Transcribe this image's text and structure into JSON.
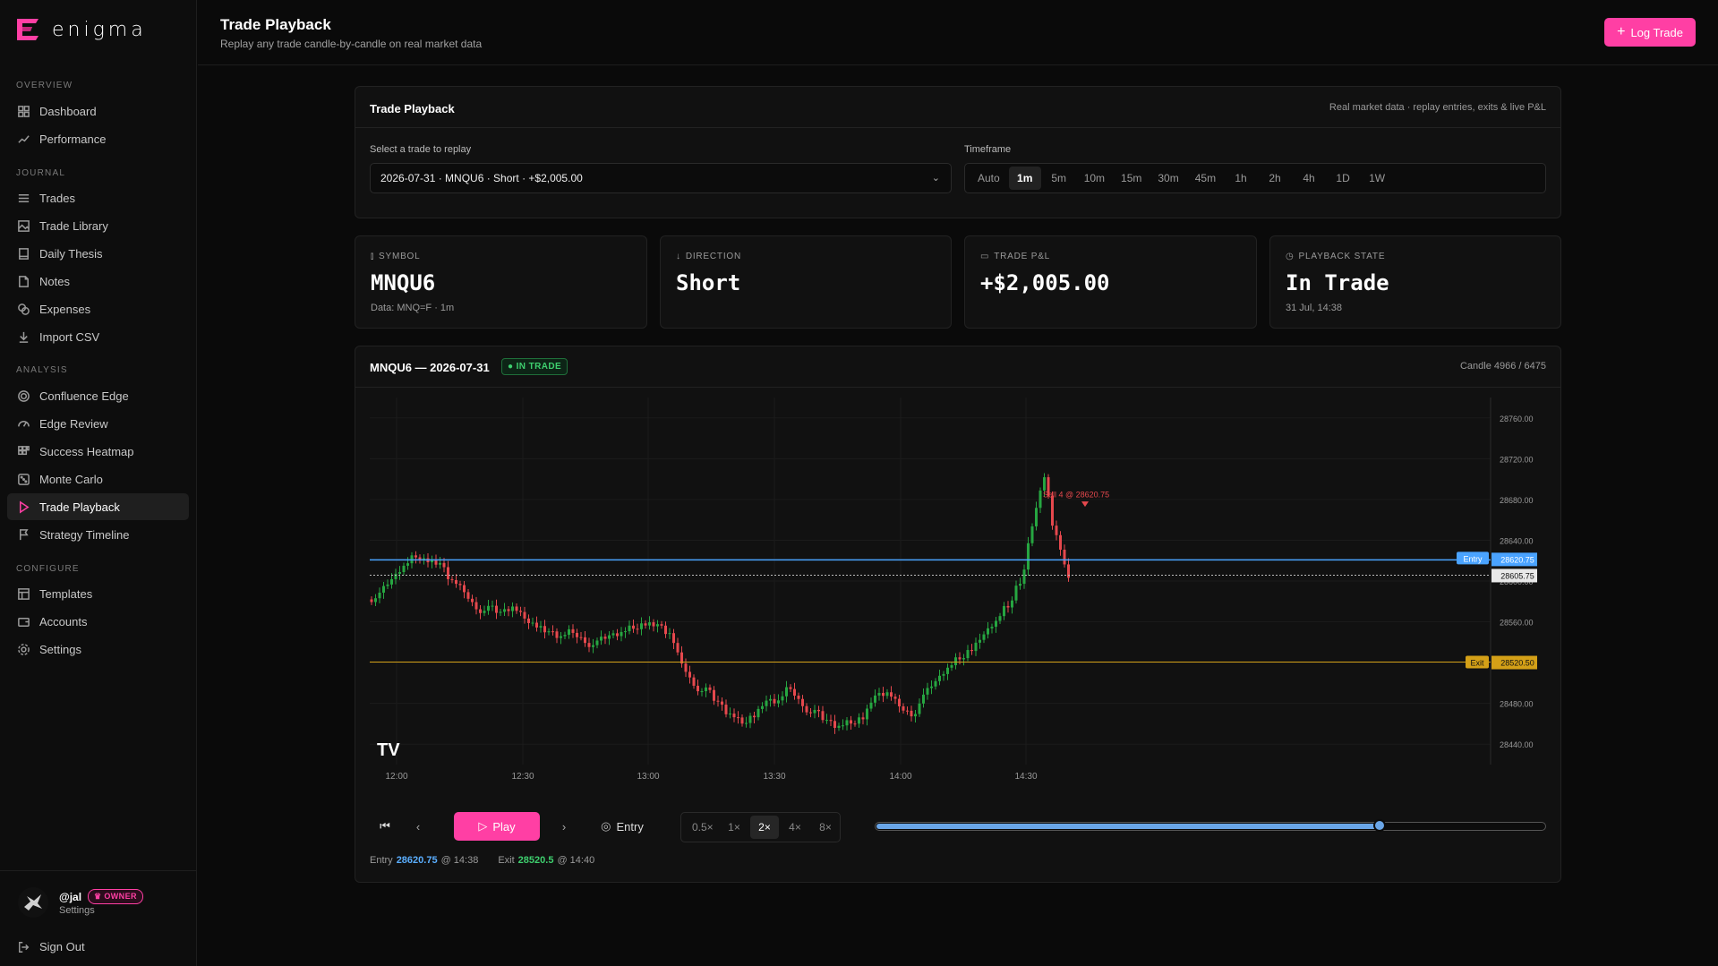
{
  "app": {
    "name": "enigma"
  },
  "sidebar": {
    "sections": [
      {
        "label": "OVERVIEW",
        "items": [
          {
            "label": "Dashboard",
            "icon": "grid-icon"
          },
          {
            "label": "Performance",
            "icon": "trend-icon"
          }
        ]
      },
      {
        "label": "JOURNAL",
        "items": [
          {
            "label": "Trades",
            "icon": "list-icon"
          },
          {
            "label": "Trade Library",
            "icon": "image-icon"
          },
          {
            "label": "Daily Thesis",
            "icon": "book-icon"
          },
          {
            "label": "Notes",
            "icon": "note-icon"
          },
          {
            "label": "Expenses",
            "icon": "coins-icon"
          },
          {
            "label": "Import CSV",
            "icon": "download-icon"
          }
        ]
      },
      {
        "label": "ANALYSIS",
        "items": [
          {
            "label": "Confluence Edge",
            "icon": "target-icon"
          },
          {
            "label": "Edge Review",
            "icon": "gauge-icon"
          },
          {
            "label": "Success Heatmap",
            "icon": "heatmap-icon"
          },
          {
            "label": "Monte Carlo",
            "icon": "dice-icon"
          },
          {
            "label": "Trade Playback",
            "icon": "play-icon",
            "active": true
          },
          {
            "label": "Strategy Timeline",
            "icon": "flag-icon"
          }
        ]
      },
      {
        "label": "CONFIGURE",
        "items": [
          {
            "label": "Templates",
            "icon": "layout-icon"
          },
          {
            "label": "Accounts",
            "icon": "wallet-icon"
          },
          {
            "label": "Settings",
            "icon": "gear-icon"
          }
        ]
      }
    ],
    "user": {
      "handle": "@jal",
      "badge": "OWNER",
      "settings_label": "Settings"
    },
    "sign_out": "Sign Out"
  },
  "header": {
    "title": "Trade Playback",
    "subtitle": "Replay any trade candle-by-candle on real market data",
    "log_trade": "Log Trade"
  },
  "selector": {
    "title": "Trade Playback",
    "note": "Real market data · replay entries, exits & live P&L",
    "trade_label": "Select a trade to replay",
    "trade_value": "2026-07-31 · MNQU6 · Short · +$2,005.00",
    "timeframe_label": "Timeframe",
    "timeframes": [
      "Auto",
      "1m",
      "5m",
      "10m",
      "15m",
      "30m",
      "45m",
      "1h",
      "2h",
      "4h",
      "1D",
      "1W"
    ],
    "timeframe_selected": "1m"
  },
  "stats": [
    {
      "label": "SYMBOL",
      "value": "MNQU6",
      "sub": "Data: MNQ=F · 1m",
      "icon": "candles-icon"
    },
    {
      "label": "DIRECTION",
      "value": "Short",
      "sub": "",
      "icon": "arrow-down-icon"
    },
    {
      "label": "TRADE P&L",
      "value": "+$2,005.00",
      "sub": "",
      "icon": "wallet-icon"
    },
    {
      "label": "PLAYBACK STATE",
      "value": "In Trade",
      "sub": "31 Jul, 14:38",
      "icon": "clock-icon"
    }
  ],
  "chart_panel": {
    "title": "MNQU6 — 2026-07-31",
    "state_badge": "IN TRADE",
    "candle_counter": "Candle 4966 / 6475",
    "entry_tag": "Entry",
    "entry_price": "28620.75",
    "current_price": "28605.75",
    "exit_tag": "Exit",
    "exit_price": "28520.50",
    "sell_annotation": "Sell 4 @ 28620.75",
    "watermark": "TV"
  },
  "chart_data": {
    "type": "candlestick",
    "x_ticks": [
      "12:00",
      "12:30",
      "13:00",
      "13:30",
      "14:00",
      "14:30"
    ],
    "y_ticks": [
      "28760.00",
      "28720.00",
      "28680.00",
      "28640.00",
      "28600.00",
      "28560.00",
      "28520.00",
      "28480.00",
      "28440.00"
    ],
    "ylim": [
      28420,
      28780
    ],
    "entry": 28620.75,
    "current": 28605.75,
    "exit": 28520.5,
    "closes": [
      28585,
      28600,
      28615,
      28625,
      28622,
      28615,
      28600,
      28590,
      28575,
      28572,
      28568,
      28575,
      28565,
      28558,
      28548,
      28545,
      28550,
      28542,
      28538,
      28545,
      28550,
      28555,
      28560,
      28555,
      28548,
      28520,
      28500,
      28492,
      28480,
      28470,
      28462,
      28470,
      28480,
      28482,
      28495,
      28480,
      28470,
      28462,
      28458,
      28462,
      28468,
      28485,
      28490,
      28478,
      28470,
      28485,
      28500,
      28515,
      28525,
      28535,
      28545,
      28560,
      28575,
      28600,
      28650,
      28700,
      28645,
      28605
    ]
  },
  "controls": {
    "play": "Play",
    "entry": "Entry",
    "speeds": [
      "0.5×",
      "1×",
      "2×",
      "4×",
      "8×"
    ],
    "speed_selected": "2×",
    "progress": 0.755
  },
  "footer_stats": {
    "entry_label": "Entry",
    "entry_price": "28620.75",
    "entry_time": "@ 14:38",
    "exit_label": "Exit",
    "exit_price": "28520.5",
    "exit_time": "@ 14:40"
  },
  "colors": {
    "accent": "#ff3fa4",
    "entry_line": "#4aa3ff",
    "exit_line": "#d4a017",
    "up": "#26a641",
    "down": "#e5484d"
  }
}
